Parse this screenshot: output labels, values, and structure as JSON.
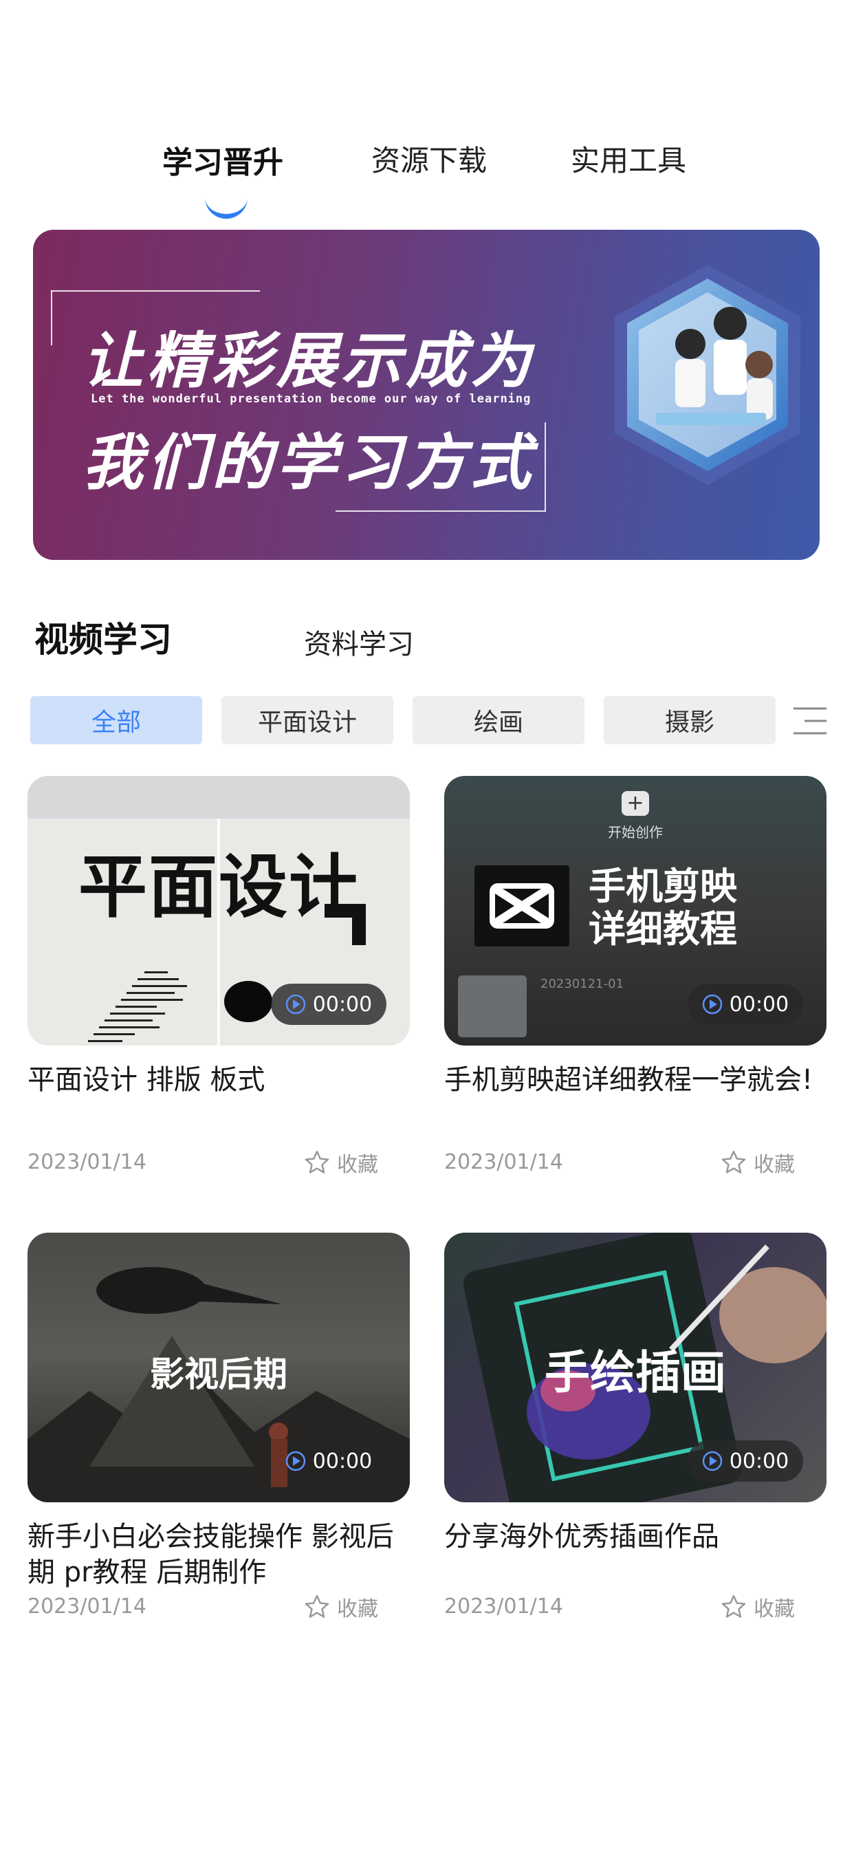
{
  "top_tabs": [
    {
      "label": "学习晋升",
      "active": true
    },
    {
      "label": "资源下载",
      "active": false
    },
    {
      "label": "实用工具",
      "active": false
    }
  ],
  "banner": {
    "title_line1": "让精彩展示成为",
    "subtitle": "Let the wonderful presentation become our way of learning",
    "title_line2": "我们的学习方式"
  },
  "section_tabs": {
    "active": "视频学习",
    "inactive": "资料学习"
  },
  "filters": {
    "chips": [
      "全部",
      "平面设计",
      "绘画",
      "摄影"
    ],
    "active_index": 0
  },
  "cards": [
    {
      "thumb_text": "平面设计",
      "duration": "00:00",
      "title": "平面设计 排版 板式",
      "date": "2023/01/14",
      "fav_label": "收藏"
    },
    {
      "thumb_text_top": "开始创作",
      "thumb_text_line1": "手机剪映",
      "thumb_text_line2": "详细教程",
      "thumb_small": "20230121-01",
      "duration": "00:00",
      "title": "手机剪映超详细教程一学就会!",
      "date": "2023/01/14",
      "fav_label": "收藏"
    },
    {
      "thumb_text": "影视后期",
      "duration": "00:00",
      "title": "新手小白必会技能操作 影视后期 pr教程 后期制作",
      "date": "2023/01/14",
      "fav_label": "收藏"
    },
    {
      "thumb_text": "手绘插画",
      "duration": "00:00",
      "title": "分享海外优秀插画作品",
      "date": "2023/01/14",
      "fav_label": "收藏"
    }
  ],
  "colors": {
    "accent": "#2f7cf6",
    "chip_active_bg": "#cfe0fb",
    "chip_active_text": "#3b82f6",
    "chip_bg": "#eeeeee",
    "muted_text": "#999999"
  },
  "icons": {
    "play": "play-circle-icon",
    "favorite": "star-outline-icon",
    "menu": "menu-icon"
  }
}
